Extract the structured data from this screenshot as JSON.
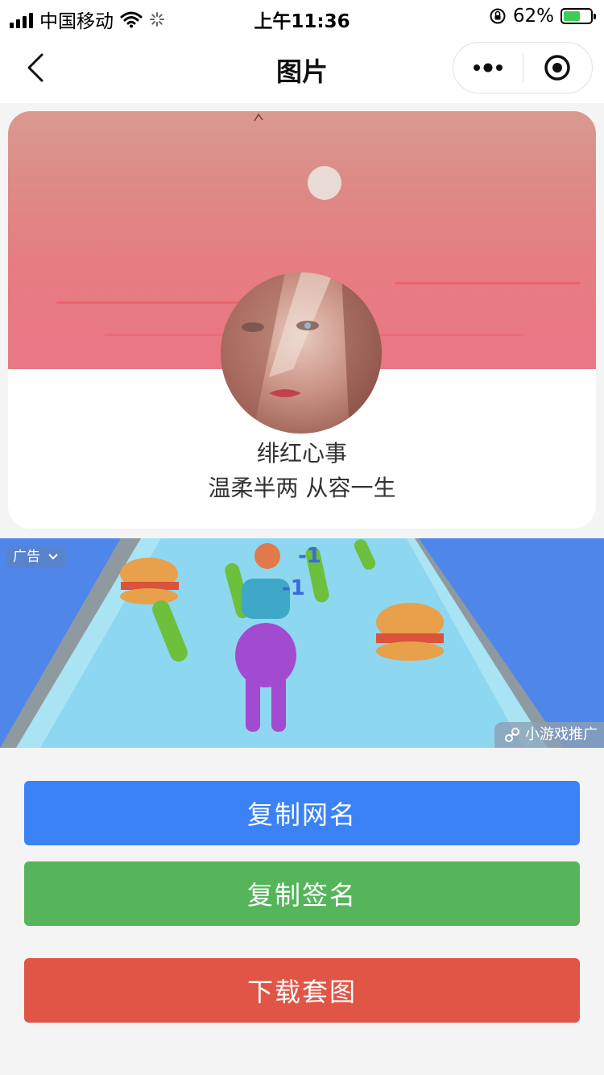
{
  "status_bar": {
    "carrier": "中国移动",
    "time": "上午11:36",
    "battery_percent": "62%",
    "battery_level": 0.62
  },
  "nav": {
    "title": "图片"
  },
  "profile": {
    "nickname": "绯红心事",
    "signature": "温柔半两 从容一生"
  },
  "ad": {
    "label": "广告",
    "source": "小游戏推广"
  },
  "buttons": {
    "copy_name": "复制网名",
    "copy_signature": "复制签名",
    "download_set": "下载套图"
  },
  "colors": {
    "blue_button": "#3b82f6",
    "green_button": "#56b55a",
    "red_button": "#e05546"
  },
  "icons": [
    "signal-icon",
    "wifi-icon",
    "loading-icon",
    "rotation-lock-icon",
    "battery-icon",
    "back-icon",
    "more-icon",
    "close-mini-program-icon",
    "chevron-down-icon",
    "link-icon"
  ]
}
